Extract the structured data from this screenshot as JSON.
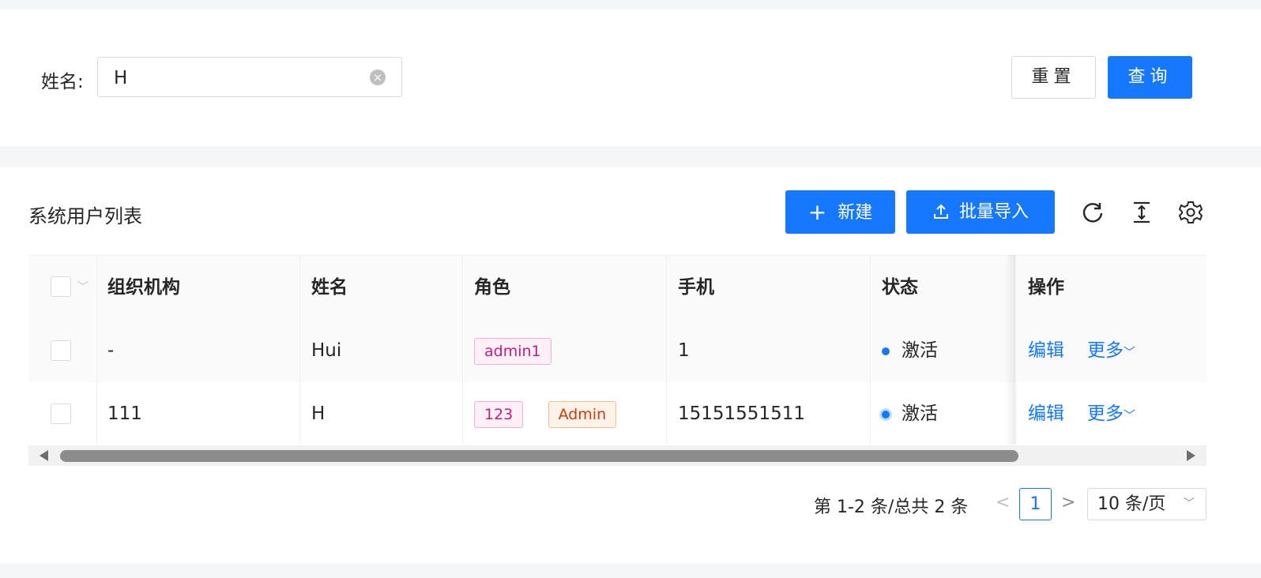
{
  "search": {
    "name_label": "姓名:",
    "name_value": "H",
    "clear_icon": "close-circle-icon",
    "reset_label": "重置",
    "query_label": "查询"
  },
  "list": {
    "title": "系统用户列表",
    "new_label": "新建",
    "import_label": "批量导入",
    "tools": [
      "reload-icon",
      "column-height-icon",
      "setting-icon"
    ]
  },
  "table": {
    "columns": [
      "组织机构",
      "姓名",
      "角色",
      "手机",
      "状态",
      "操作"
    ],
    "rows": [
      {
        "org": "-",
        "name": "Hui",
        "roles": [
          "admin1"
        ],
        "phone": "1",
        "status": "激活",
        "edit": "编辑",
        "more": "更多"
      },
      {
        "org": "111",
        "name": "H",
        "roles": [
          "123",
          "Admin"
        ],
        "phone": "15151551511",
        "status": "激活",
        "edit": "编辑",
        "more": "更多"
      }
    ]
  },
  "pagination": {
    "total_text": "第 1-2 条/总共 2 条",
    "current": "1",
    "page_size": "10 条/页"
  },
  "colors": {
    "primary": "#1677ff",
    "pink_tag": "#c41d7f",
    "orange_tag": "#d4380d"
  }
}
